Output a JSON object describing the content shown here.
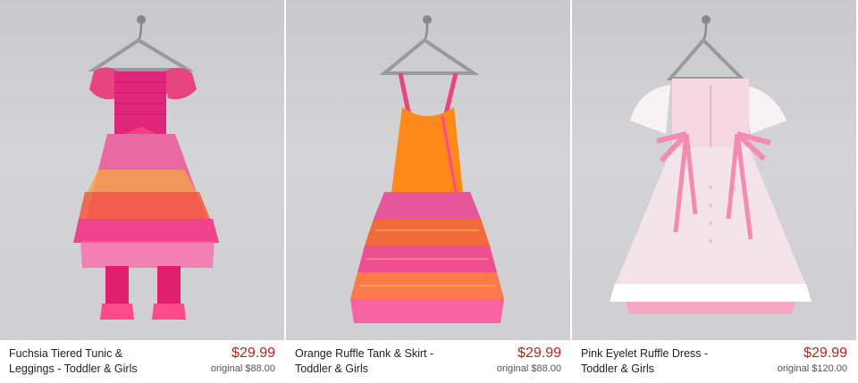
{
  "products": [
    {
      "name_line1": "Fuchsia Tiered Tunic &",
      "name_line2": "Leggings - Toddler & Girls",
      "price": "$29.99",
      "original": "original $88.00",
      "image_icon": "fuchsia-tunic-dress-image"
    },
    {
      "name_line1": "Orange Ruffle Tank & Skirt -",
      "name_line2": "Toddler & Girls",
      "price": "$29.99",
      "original": "original $88.00",
      "image_icon": "orange-ruffle-dress-image"
    },
    {
      "name_line1": "Pink Eyelet Ruffle Dress -",
      "name_line2": "Toddler & Girls",
      "price": "$29.99",
      "original": "original $120.00",
      "image_icon": "pink-eyelet-dress-image"
    }
  ],
  "colors": {
    "price": "#b2261c",
    "photo_background": "#d0d0d2",
    "name_text": "#222222"
  }
}
